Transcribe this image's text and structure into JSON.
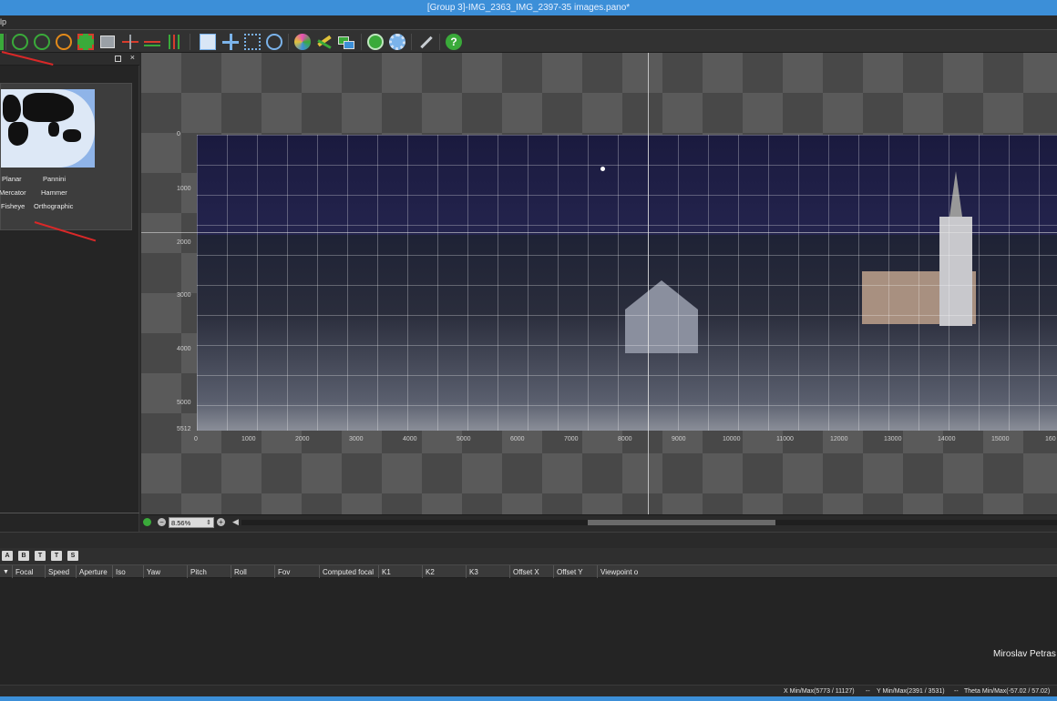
{
  "window": {
    "title": "[Group 3]-IMG_2363_IMG_2397-35 images.pano*"
  },
  "menubar": {
    "partial_item": "lp"
  },
  "toolbar": {
    "icons": [
      {
        "name": "rotate-yaw-icon",
        "color": "#3aaa3a"
      },
      {
        "name": "rotate-pitch-icon",
        "color": "#3aaa3a"
      },
      {
        "name": "rotate-roll-icon",
        "color": "#e28a1a"
      },
      {
        "name": "crop-icon",
        "color": "#d83c2c"
      },
      {
        "name": "fit-icon",
        "color": "#9aa0a6"
      },
      {
        "name": "horizon-icon",
        "color": "#d83c2c"
      },
      {
        "name": "vertical-lines-icon",
        "color": "#d83c2c"
      },
      {
        "name": "select-icon",
        "color": "#7bb3ea"
      },
      {
        "name": "move-icon",
        "color": "#7bb3ea"
      },
      {
        "name": "anchor-points-icon",
        "color": "#7bb3ea"
      },
      {
        "name": "target-icon",
        "color": "#7bb3ea"
      },
      {
        "name": "auto-color-icon",
        "color": "#e84fb5"
      },
      {
        "name": "color-balance-icon",
        "color": "#e0c23a"
      },
      {
        "name": "layers-icon",
        "color": "#3aaa3a"
      },
      {
        "name": "preview-icon",
        "color": "#3aaa3a"
      },
      {
        "name": "settings-icon",
        "color": "#7bb3ea"
      },
      {
        "name": "tools-icon",
        "color": "#9aa0a6"
      },
      {
        "name": "help-icon",
        "color": "#3aaa3a"
      }
    ]
  },
  "projections": {
    "items": [
      "Planar",
      "Pannini",
      "Mercator",
      "Hammer",
      "Fisheye",
      "Orthographic"
    ],
    "map_colors": {
      "ocean": "#8fb4e8",
      "land": "#111111",
      "highlight": "#ffffff"
    }
  },
  "canvas": {
    "y_ticks": [
      "0",
      "1000",
      "2000",
      "3000",
      "4000",
      "5000",
      "5512"
    ],
    "x_ticks": [
      "0",
      "1000",
      "2000",
      "3000",
      "4000",
      "5000",
      "6000",
      "7000",
      "8000",
      "9000",
      "10000",
      "11000",
      "12000",
      "13000",
      "14000",
      "15000",
      "160"
    ]
  },
  "zoom": {
    "value": "8.56%"
  },
  "bottom_buttons": [
    "A",
    "B",
    "T",
    "T",
    "S"
  ],
  "columns": [
    "Focal",
    "Speed",
    "Aperture",
    "Iso",
    "Yaw",
    "Pitch",
    "Roll",
    "Fov",
    "Computed focal",
    "K1",
    "K2",
    "K3",
    "Offset X",
    "Offset Y",
    "Viewpoint o"
  ],
  "watermark": "Miroslav Petras",
  "status": {
    "x": "X Min/Max(5773 / 11127)",
    "y": "Y Min/Max(2391 / 3531)",
    "theta": "Theta Min/Max(-57.02 / 57.02)",
    "separator": "--"
  }
}
